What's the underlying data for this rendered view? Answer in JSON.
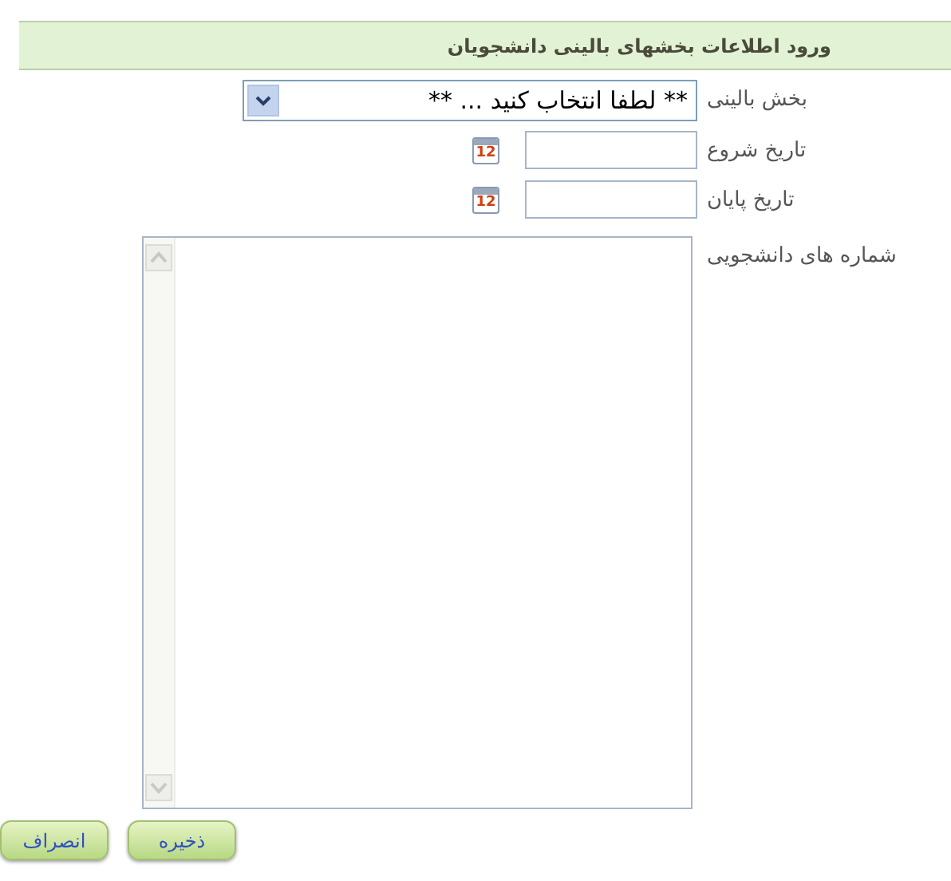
{
  "header": {
    "title": "ورود اطلاعات بخشهای بالینی دانشجویان"
  },
  "fields": [
    {
      "kind": "select",
      "label": "بخش بالینی",
      "value": "** لطفا انتخاب کنید ... **"
    },
    {
      "kind": "date",
      "label": "تاریخ شروع",
      "icon_text": "12"
    },
    {
      "kind": "date",
      "label": "تاریخ پایان",
      "icon_text": "12"
    },
    {
      "kind": "textarea",
      "label": "شماره های دانشجویی"
    }
  ],
  "buttons": [
    "ذخیره",
    "انصراف"
  ]
}
